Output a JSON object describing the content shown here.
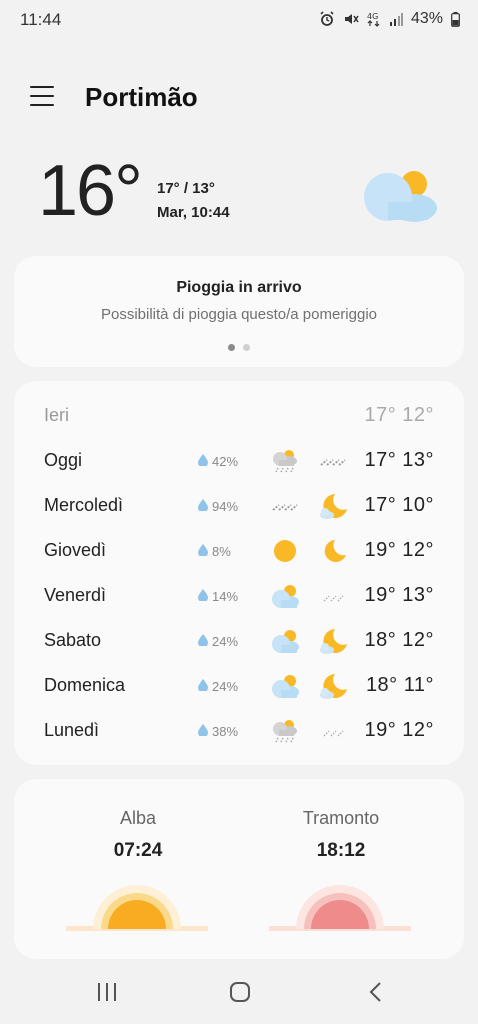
{
  "status": {
    "time": "11:44",
    "battery": "43%"
  },
  "header": {
    "city": "Portimão"
  },
  "current": {
    "temp": "16°",
    "hilo": "17° / 13°",
    "datetime": "Mar, 10:44",
    "icon": "partly-cloudy-icon"
  },
  "alert": {
    "title": "Pioggia in arrivo",
    "subtitle": "Possibilità di pioggia questo/a pomeriggio",
    "page_index": 0,
    "page_count": 2
  },
  "forecast": {
    "yesterday": {
      "day": "Ieri",
      "temps": "17° 12°"
    },
    "days": [
      {
        "day": "Oggi",
        "rain": "42%",
        "day_icon": "cloud-sun-rain-icon",
        "night_icon": "rain-icon",
        "temps": "17° 13°"
      },
      {
        "day": "Mercoledì",
        "rain": "94%",
        "day_icon": "rain-icon",
        "night_icon": "cloud-moon-icon",
        "temps": "17° 10°"
      },
      {
        "day": "Giovedì",
        "rain": "8%",
        "day_icon": "sun-icon",
        "night_icon": "moon-icon",
        "temps": "19° 12°"
      },
      {
        "day": "Venerdì",
        "rain": "14%",
        "day_icon": "cloud-sun-icon",
        "night_icon": "light-rain-icon",
        "temps": "19° 13°"
      },
      {
        "day": "Sabato",
        "rain": "24%",
        "day_icon": "cloud-sun-icon",
        "night_icon": "cloud-moon-icon",
        "temps": "18° 12°"
      },
      {
        "day": "Domenica",
        "rain": "24%",
        "day_icon": "cloud-sun-icon",
        "night_icon": "cloud-moon-icon",
        "temps": "18° 11°"
      },
      {
        "day": "Lunedì",
        "rain": "38%",
        "day_icon": "cloud-sun-rain-icon",
        "night_icon": "light-rain-icon",
        "temps": "19° 12°"
      }
    ]
  },
  "sun": {
    "sunrise_label": "Alba",
    "sunrise_time": "07:24",
    "sunset_label": "Tramonto",
    "sunset_time": "18:12"
  },
  "colors": {
    "background": "#f2f2f2",
    "card": "#fafafa",
    "sun": "#f9b826",
    "cloud": "#b9dcf5",
    "sunset": "#ee8c8c"
  }
}
